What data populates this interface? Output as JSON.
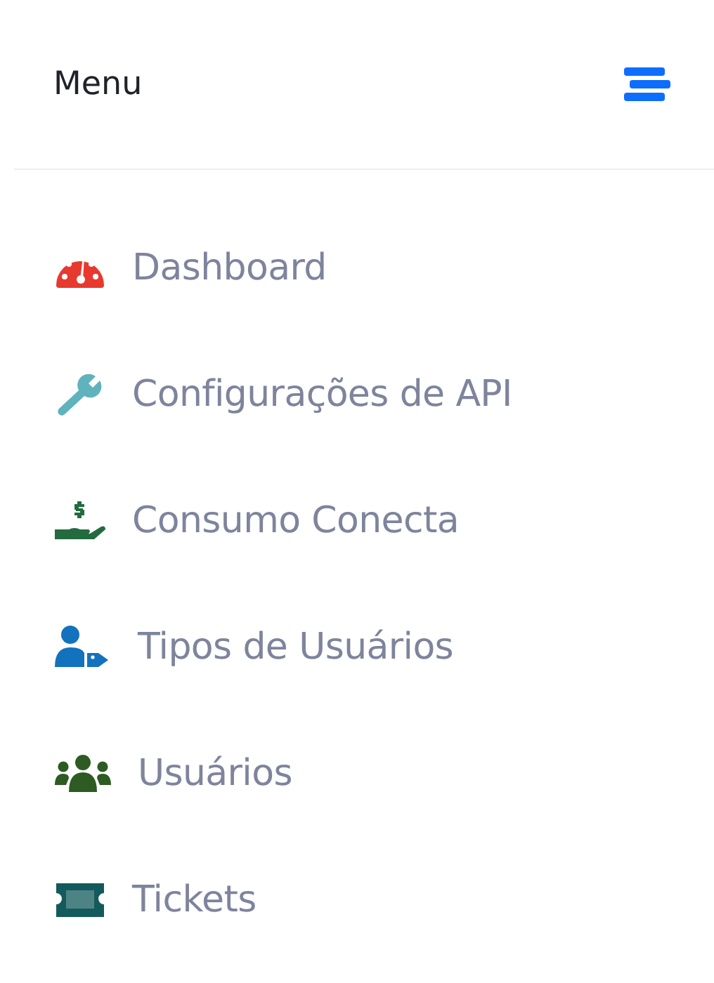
{
  "header": {
    "title": "Menu"
  },
  "menu_items": [
    {
      "kind": "gauge",
      "label": "Dashboard",
      "color": "#e8392e"
    },
    {
      "kind": "wrench",
      "label": "Configurações de API",
      "color": "#5fb3bd"
    },
    {
      "kind": "money-hand",
      "label": "Consumo Conecta",
      "color": "#236b3f"
    },
    {
      "kind": "user-tag",
      "label": "Tipos de Usuários",
      "color": "#1372bd"
    },
    {
      "kind": "users",
      "label": "Usuários",
      "color": "#2d5b22"
    },
    {
      "kind": "ticket",
      "label": "Tickets",
      "color": "#135a5c"
    }
  ]
}
